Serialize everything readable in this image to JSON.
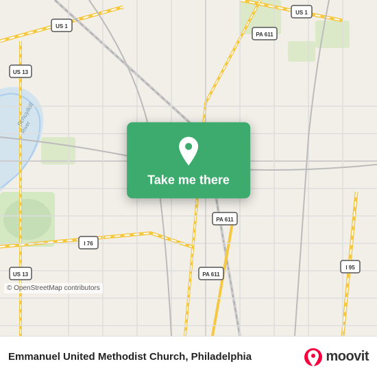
{
  "map": {
    "background_color": "#f2efe9",
    "osm_credit": "© OpenStreetMap contributors"
  },
  "cta": {
    "label": "Take me there",
    "pin_color": "#ffffff",
    "card_color": "#3daa6e"
  },
  "bottom_bar": {
    "title": "Emmanuel United Methodist Church, Philadelphia",
    "logo_text": "moovit"
  }
}
